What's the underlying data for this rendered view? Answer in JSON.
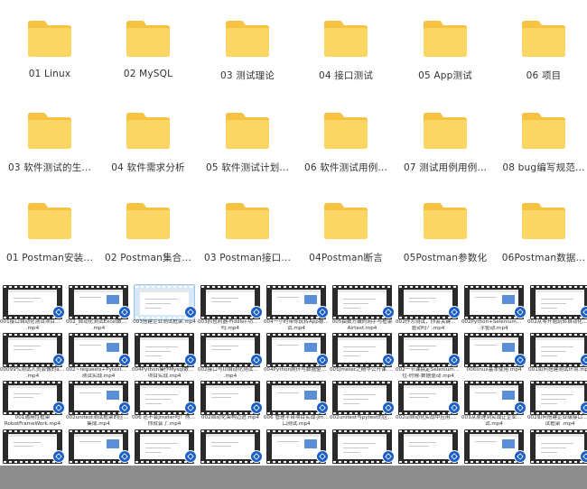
{
  "folders_row1": [
    {
      "label": "01 Linux",
      "icon": "folder-icon"
    },
    {
      "label": "02 MySQL",
      "icon": "folder-icon"
    },
    {
      "label": "03 测试理论",
      "icon": "folder-icon"
    },
    {
      "label": "04 接口测试",
      "icon": "folder-icon"
    },
    {
      "label": "05 App测试",
      "icon": "folder-icon"
    },
    {
      "label": "06 项目",
      "icon": "folder-icon"
    }
  ],
  "folders_row2": [
    {
      "label": "03 软件测试的生...",
      "icon": "folder-icon"
    },
    {
      "label": "04 软件需求分析",
      "icon": "folder-icon"
    },
    {
      "label": "05 软件测试计划...",
      "icon": "folder-icon"
    },
    {
      "label": "06 软件测试用例...",
      "icon": "folder-icon"
    },
    {
      "label": "07 测试用例用例...",
      "icon": "folder-icon"
    },
    {
      "label": "08 bug编写规范...",
      "icon": "folder-icon"
    }
  ],
  "folders_row3": [
    {
      "label": "01 Postman安装...",
      "icon": "folder-icon"
    },
    {
      "label": "02 Postman集合...",
      "icon": "folder-icon"
    },
    {
      "label": "03 Postman接口...",
      "icon": "folder-icon"
    },
    {
      "label": "04Postman断言",
      "icon": "folder-icon"
    },
    {
      "label": "05Postman参数化",
      "icon": "folder-icon"
    },
    {
      "label": "06Postman数据...",
      "icon": "folder-icon"
    }
  ],
  "videos_row1": [
    {
      "l1": "001接口自动化测试项目实战",
      "l2": ".mp4"
    },
    {
      "l1": "002_自动化测试Excel数据驱动",
      "l2": ".mp4"
    },
    {
      "l1": "003搭建企业测试框架.mp4",
      "l2": ""
    },
    {
      "l1": "003抓包利器-Fiddler-功能全了",
      "l2": "吗.mp4"
    },
    {
      "l1": "004一小时带你玩转App稳定性测",
      "l2": "试.mp4"
    },
    {
      "l1": "005由数方嫩的网手与框架",
      "l2": "Airtest.mp4"
    },
    {
      "l1": "002作为测试，你会关键字和数据",
      "l2": "驱动吗？.mp4"
    },
    {
      "l1": "002Python+Selenium实现关键",
      "l2": "字驱动.mp4"
    },
    {
      "l1": "002从零开始玩转自动化.mp4",
      "l2": ""
    }
  ],
  "videos_row2": [
    {
      "l1": "00099%测试人员会做的app测试",
      "l2": ".mp4"
    },
    {
      "l1": "002~requests+Pytest接口自动化",
      "l2": "测试实战.mp4"
    },
    {
      "l1": "004Python操作Mysql数据库综合",
      "l2": "项目实战.mp4"
    },
    {
      "l1": "002接口与UI自动化测试的应用",
      "l2": ".mp4"
    },
    {
      "l1": "004Python爬环与数据驱动.mp4",
      "l2": ""
    },
    {
      "l1": "005Jmeter之精华公开课.mp4",
      "l2": ""
    },
    {
      "l1": "002一节课搞定Selenium元素定",
      "l2": "位-时候-数据驱动.mp4"
    },
    {
      "l1": "006linux基本使用.mp4",
      "l2": ""
    },
    {
      "l1": "001如何搭建测试环境.mp4",
      "l2": ""
    }
  ],
  "videos_row3": [
    {
      "l1": "001通用性框架",
      "l2": "RobotFrameWork.mp4"
    },
    {
      "l1": "002unitest测试框架的应用与数据",
      "l2": "集成.mp4"
    },
    {
      "l1": "006 还不会Jmeter吗！然了这个",
      "l2": "你就会了.mp4"
    },
    {
      "l1": "002自动化架构迈进.mp4",
      "l2": ""
    },
    {
      "l1": "006 管理平台项目实战-Jmeter接",
      "l2": "口测试.mp4"
    },
    {
      "l1": "002unitest与pytest的区别.mp4",
      "l2": ""
    },
    {
      "l1": "002ui自动化实战中应用.mp4",
      "l2": ""
    },
    {
      "l1": "003从原理到实战让企业的接口测",
      "l2": "试.mp4"
    },
    {
      "l1": "002如何搭建企业级接口自动化测",
      "l2": "试框架 .mp4"
    }
  ],
  "videos_row4": [
    {
      "l1": "",
      "l2": ""
    },
    {
      "l1": "",
      "l2": ""
    },
    {
      "l1": "",
      "l2": ""
    },
    {
      "l1": "",
      "l2": ""
    },
    {
      "l1": "",
      "l2": ""
    },
    {
      "l1": "",
      "l2": ""
    },
    {
      "l1": "",
      "l2": ""
    },
    {
      "l1": "",
      "l2": ""
    },
    {
      "l1": "",
      "l2": ""
    }
  ],
  "colors": {
    "folder": "#fcd664",
    "folder_back": "#f5c242",
    "badge": "#1c5fc4",
    "selection": "#d7e8f9"
  }
}
